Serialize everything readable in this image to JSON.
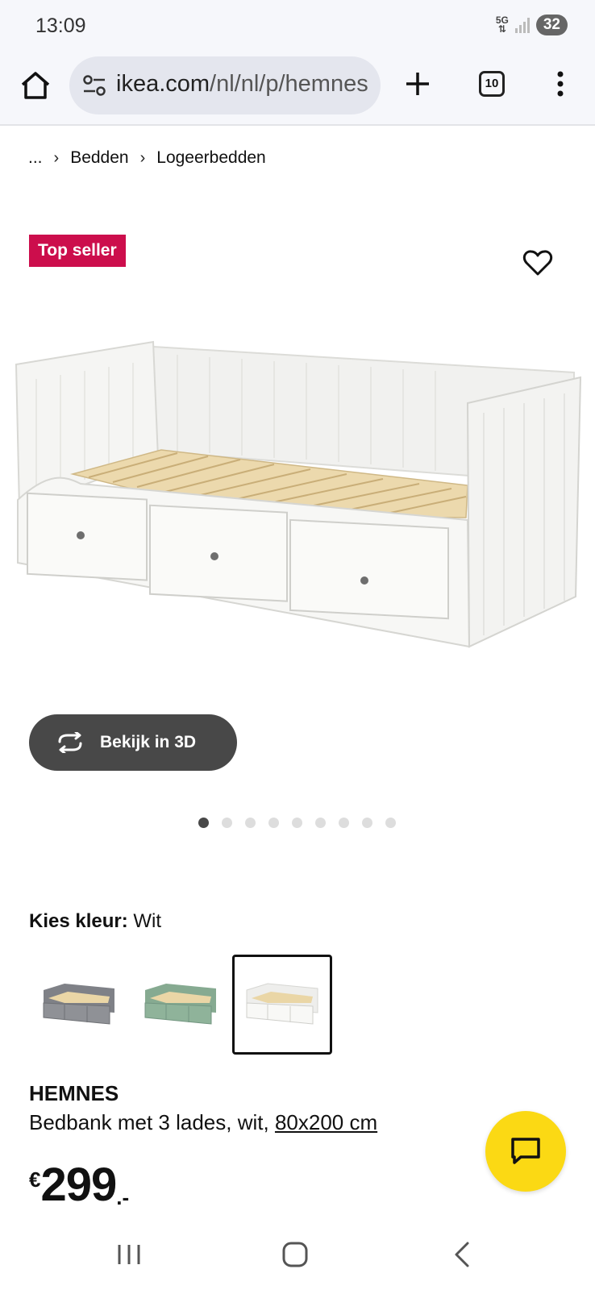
{
  "status_bar": {
    "time": "13:09",
    "network": "5G",
    "battery": "32"
  },
  "browser": {
    "url_domain": "ikea.com",
    "url_path": "/nl/nl/p/hemnes",
    "tab_count": "10"
  },
  "breadcrumb": {
    "ellipsis": "...",
    "items": [
      "Bedden",
      "Logeerbedden"
    ]
  },
  "badge": "Top seller",
  "view_3d_label": "Bekijk in 3D",
  "carousel": {
    "total": 9,
    "active": 1
  },
  "color": {
    "label": "Kies kleur:",
    "value": "Wit",
    "options": [
      {
        "name": "grey",
        "color": "#8f9196"
      },
      {
        "name": "green",
        "color": "#8fb39a"
      },
      {
        "name": "white",
        "color": "#f4f4f2",
        "selected": true
      }
    ]
  },
  "product": {
    "name": "HEMNES",
    "description": "Bedbank met 3 lades, wit, ",
    "size": "80x200 cm",
    "currency": "€",
    "price": "299",
    "price_suffix": ".-"
  },
  "colors": {
    "badge": "#cc0e4c",
    "chat_fab": "#fbd914",
    "button_dark": "#484848"
  }
}
